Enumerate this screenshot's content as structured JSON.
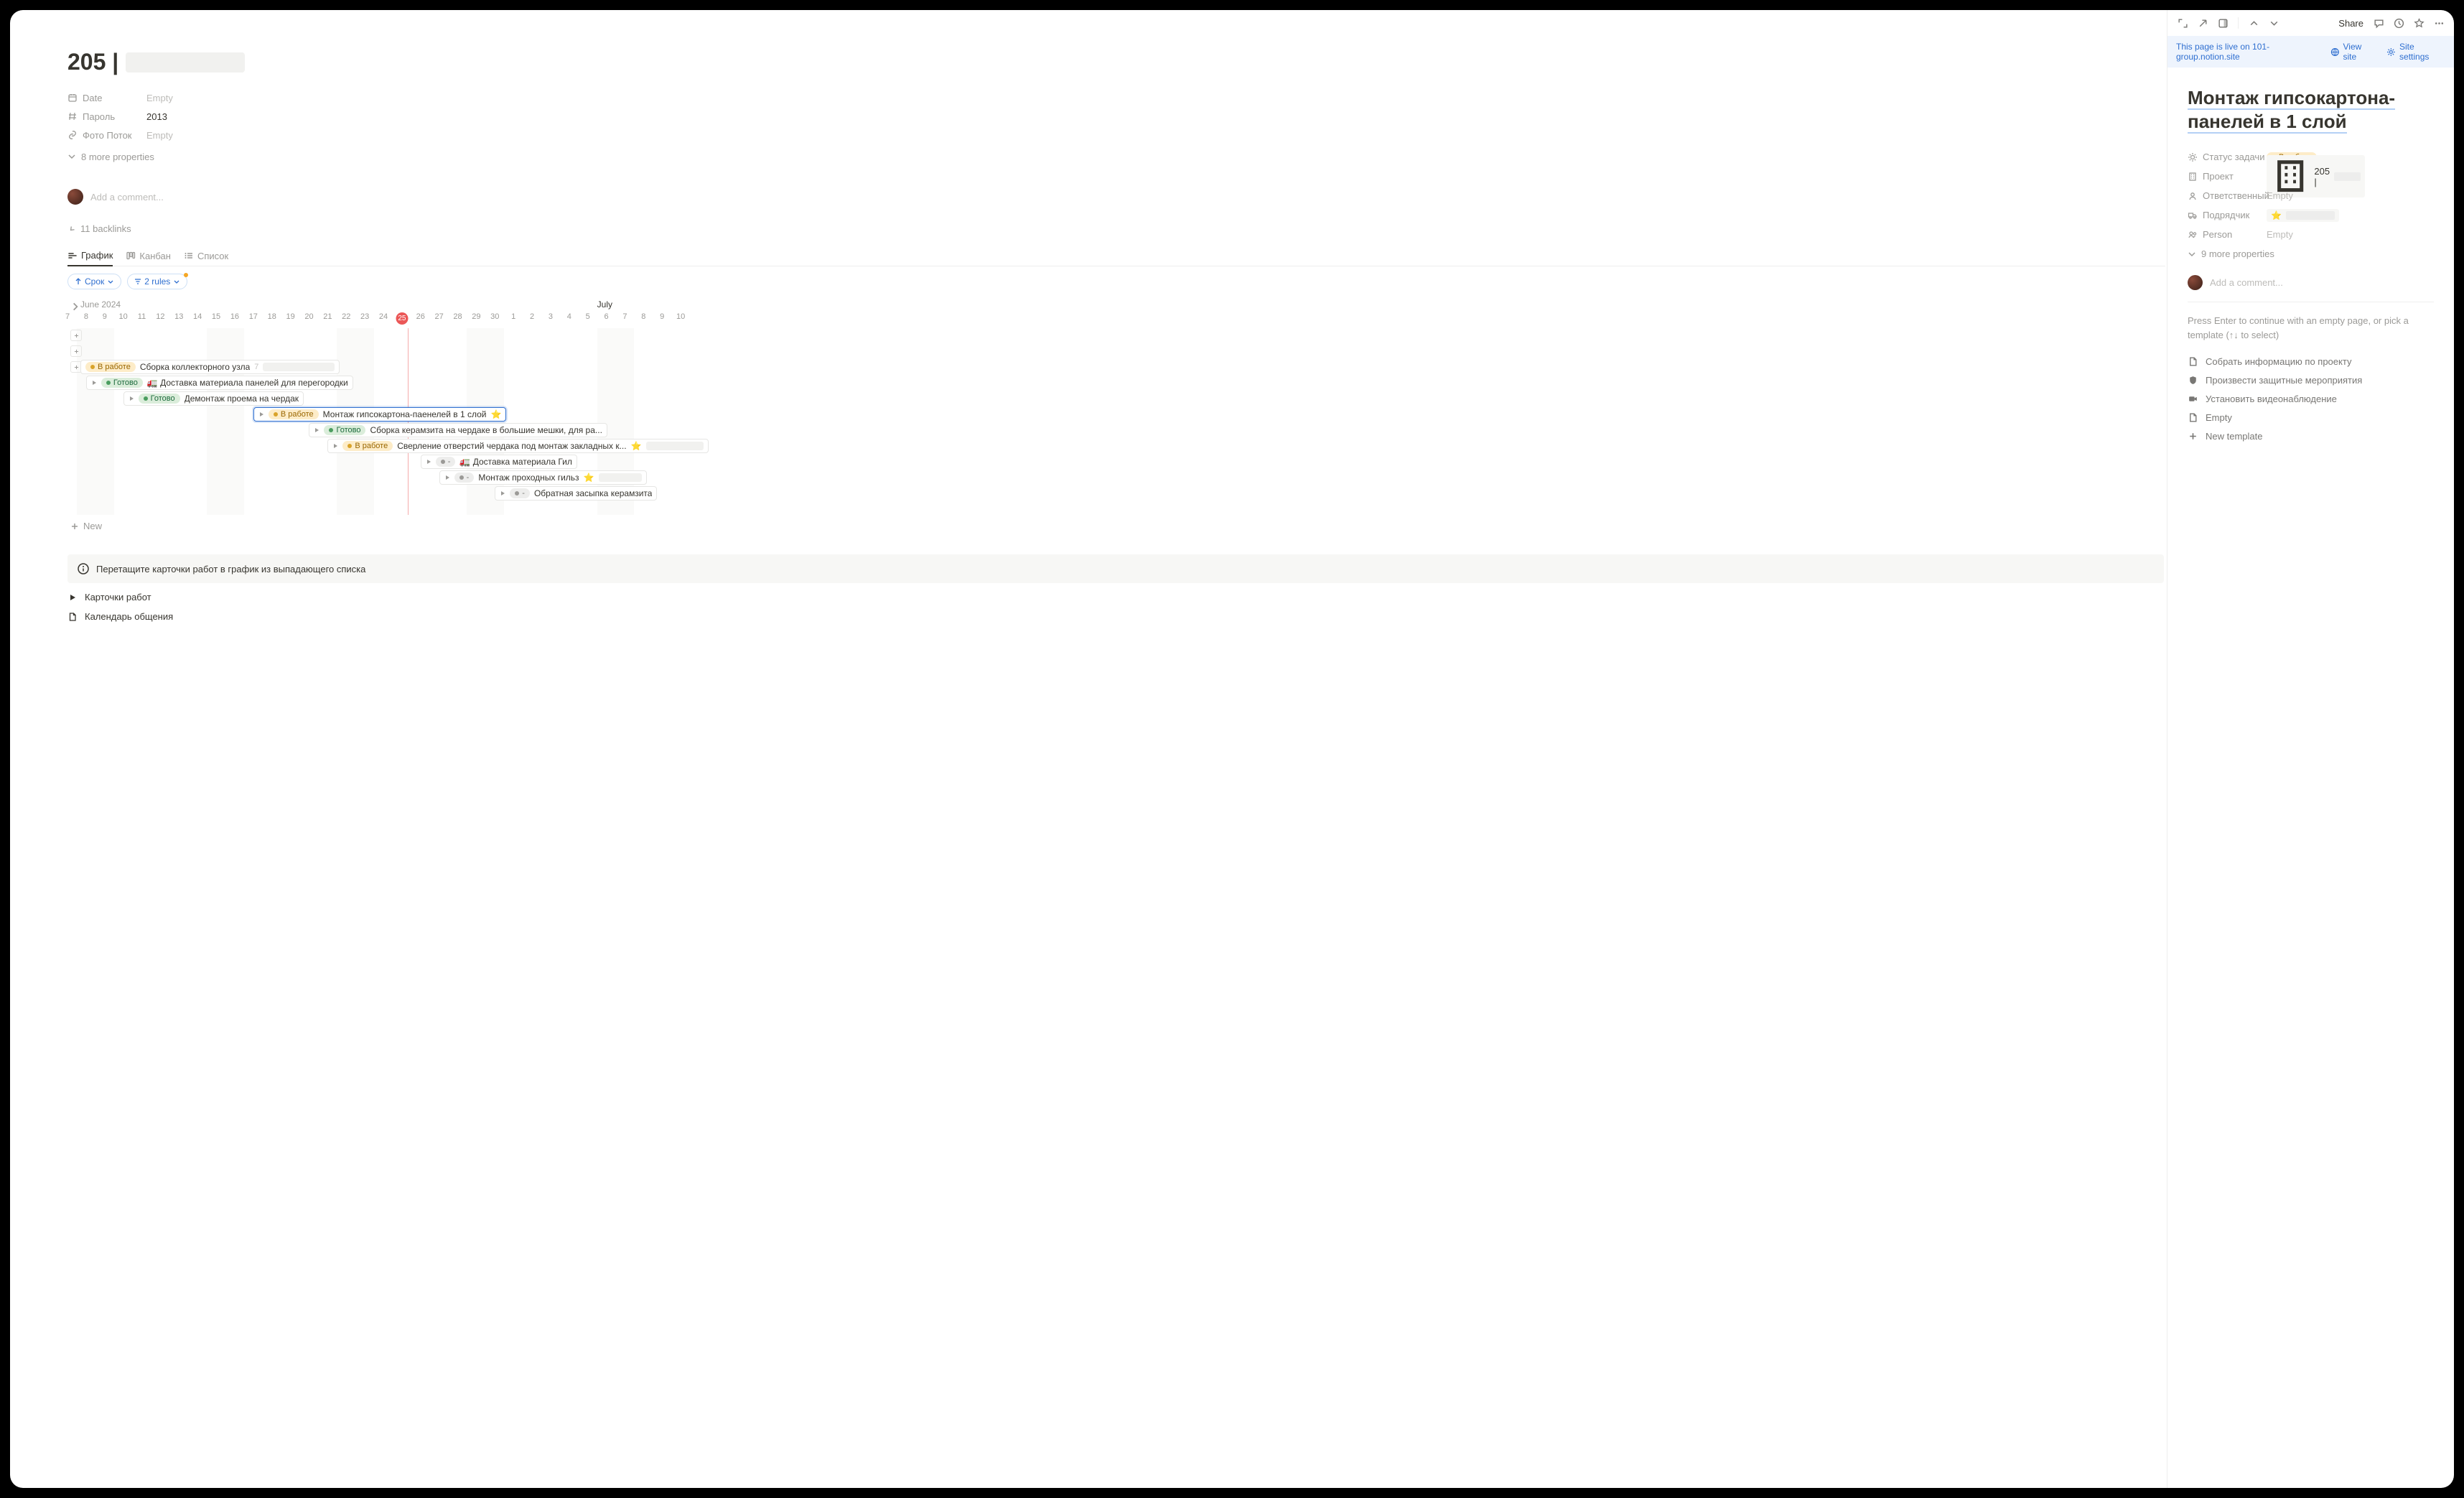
{
  "main": {
    "title_prefix": "205 |",
    "properties": [
      {
        "icon": "calendar",
        "label": "Date",
        "value": "Empty",
        "empty": true
      },
      {
        "icon": "hash",
        "label": "Пароль",
        "value": "2013",
        "empty": false
      },
      {
        "icon": "link",
        "label": "Фото Поток",
        "value": "Empty",
        "empty": true
      }
    ],
    "more_properties": "8 more properties",
    "comment_placeholder": "Add a comment...",
    "backlinks": "11 backlinks",
    "tabs": [
      {
        "icon": "timeline",
        "label": "График",
        "active": true
      },
      {
        "icon": "kanban",
        "label": "Канбан",
        "active": false
      },
      {
        "icon": "list",
        "label": "Список",
        "active": false
      }
    ],
    "filters": {
      "sort_label": "Срок",
      "rules_label": "2 rules"
    },
    "timeline": {
      "month_left": "June 2024",
      "month_right": "July",
      "day_start": 7,
      "day_count": 34,
      "today": 25,
      "rows": [
        {
          "kind": "handle",
          "icon": "plus"
        },
        {
          "kind": "handle",
          "icon": "plus"
        },
        {
          "kind": "bar",
          "start": 7,
          "end": 15,
          "status": "work",
          "status_label": "В работе",
          "title": "Сборка коллекторного узла",
          "handle_icon": "plus",
          "count": "7",
          "redact_w": 100
        },
        {
          "kind": "bar",
          "start": 8,
          "end": 16,
          "status": "done",
          "status_label": "Готово",
          "title": "🚛 Доставка материала панелей для перегородки",
          "tri": true
        },
        {
          "kind": "bar",
          "start": 10,
          "end": 17,
          "status": "done",
          "status_label": "Готово",
          "title": "Демонтаж проема на чердак",
          "tri": true
        },
        {
          "kind": "bar",
          "start": 17,
          "end": 30,
          "status": "work",
          "status_label": "В работе",
          "title": "Монтаж гипсокартона-паенелей в 1 слой",
          "tri": true,
          "star": true,
          "selected": true
        },
        {
          "kind": "bar",
          "start": 20,
          "end": 31,
          "status": "done",
          "status_label": "Готово",
          "title": "Сборка керамзита на чердаке в большие мешки, для ра...",
          "tri": true
        },
        {
          "kind": "bar",
          "start": 21,
          "end": 34,
          "status": "work",
          "status_label": "В работе",
          "title": "Сверление отверстий чердака под монтаж закладных к...",
          "tri": true,
          "star": true,
          "redact_w": 80
        },
        {
          "kind": "bar",
          "start": 26,
          "end": 28,
          "status": "neutral",
          "status_label": "-",
          "title": "🚛 Доставка материала Гил",
          "tri": true
        },
        {
          "kind": "bar",
          "start": 27,
          "end": 29,
          "status": "neutral",
          "status_label": "-",
          "title": "Монтаж проходных гильз",
          "tri": true,
          "star": true,
          "redact_w": 60
        },
        {
          "kind": "bar",
          "start": 30,
          "end": 32,
          "status": "neutral",
          "status_label": "-",
          "title": "Обратная засыпка керамзита",
          "tri": true
        }
      ],
      "new_label": "New"
    },
    "info_note": "Перетащите карточки работ в график из выпадающего списка",
    "bottom_links": [
      {
        "icon": "triangle",
        "label": "Карточки работ"
      },
      {
        "icon": "page",
        "label": "Календарь общения"
      }
    ]
  },
  "side": {
    "share": "Share",
    "banner_text": "This page is live on 101-group.notion.site",
    "banner_view": "View site",
    "banner_settings": "Site settings",
    "title": "Монтаж гипсокартона-панелей в 1 слой",
    "properties": [
      {
        "icon": "sun",
        "label": "Статус задачи",
        "kind": "status",
        "status_class": "work",
        "status_label": "В работе"
      },
      {
        "icon": "building",
        "label": "Проект",
        "kind": "project",
        "text": "205 |"
      },
      {
        "icon": "person",
        "label": "Ответственный",
        "kind": "empty",
        "text": "Empty"
      },
      {
        "icon": "truck",
        "label": "Подрядчик",
        "kind": "contractor"
      },
      {
        "icon": "people",
        "label": "Person",
        "kind": "empty",
        "text": "Empty"
      }
    ],
    "more_properties": "9 more properties",
    "comment_placeholder": "Add a comment...",
    "hint": "Press Enter to continue with an empty page, or pick a template (↑↓ to select)",
    "templates": [
      {
        "icon": "page",
        "label": "Собрать информацию по проекту"
      },
      {
        "icon": "shield",
        "label": "Произвести защитные мероприятия"
      },
      {
        "icon": "camera",
        "label": "Установить видеонаблюдение"
      },
      {
        "icon": "page",
        "label": "Empty"
      },
      {
        "icon": "plus",
        "label": "New template"
      }
    ]
  }
}
